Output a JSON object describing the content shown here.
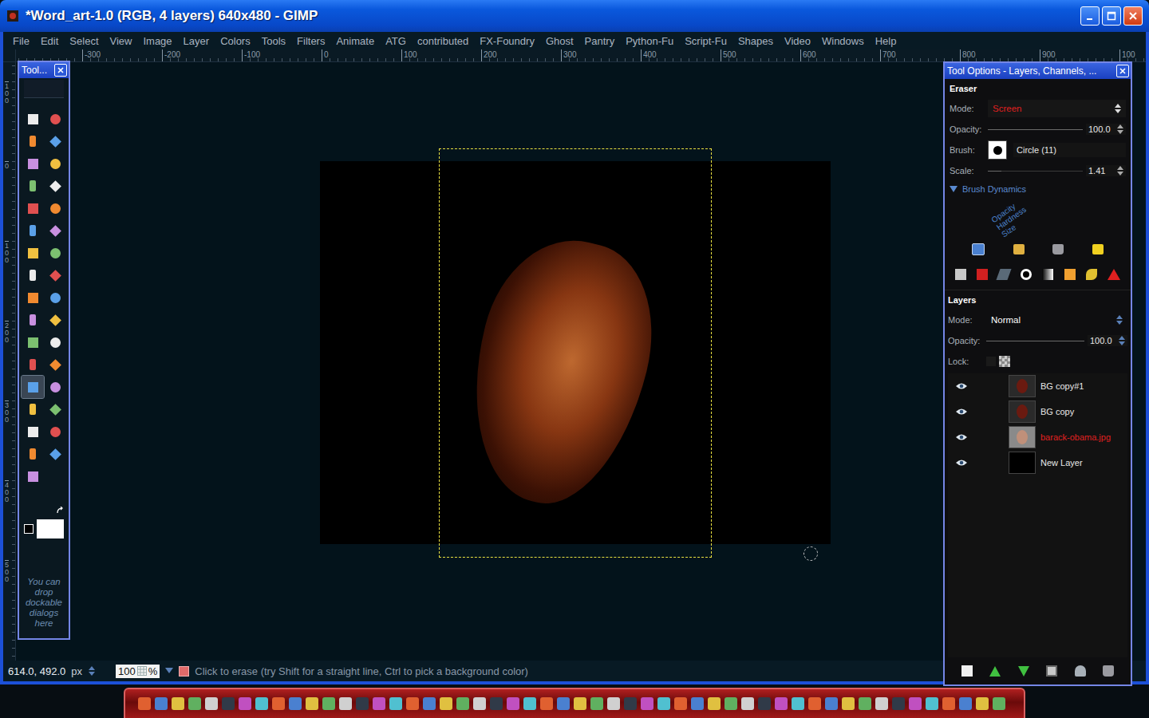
{
  "window": {
    "title": "*Word_art-1.0 (RGB, 4 layers) 640x480 - GIMP"
  },
  "menu": [
    "File",
    "Edit",
    "Select",
    "View",
    "Image",
    "Layer",
    "Colors",
    "Tools",
    "Filters",
    "Animate",
    "ATG",
    "contributed",
    "FX-Foundry",
    "Ghost",
    "Pantry",
    "Python-Fu",
    "Script-Fu",
    "Shapes",
    "Video",
    "Windows",
    "Help"
  ],
  "rulers": {
    "top": [
      "-300",
      "-200",
      "-100",
      "0",
      "100",
      "200",
      "300",
      "400",
      "500",
      "600",
      "700",
      "800",
      "900",
      "100"
    ],
    "left": [
      "100",
      "0",
      "100",
      "200",
      "300",
      "400",
      "500"
    ]
  },
  "toolbox": {
    "title": "Tool...",
    "tools": [
      {
        "selected": false
      },
      {
        "selected": false
      },
      {
        "selected": false
      },
      {
        "selected": false
      },
      {
        "selected": false
      },
      {
        "selected": false
      },
      {
        "selected": false
      },
      {
        "selected": false
      },
      {
        "selected": false
      },
      {
        "selected": false
      },
      {
        "selected": false
      },
      {
        "selected": false
      },
      {
        "selected": false
      },
      {
        "selected": false
      },
      {
        "selected": false
      },
      {
        "selected": false
      },
      {
        "selected": false
      },
      {
        "selected": false
      },
      {
        "selected": false
      },
      {
        "selected": false
      },
      {
        "selected": false
      },
      {
        "selected": false
      },
      {
        "selected": false
      },
      {
        "selected": false
      },
      {
        "selected": true
      },
      {
        "selected": false
      },
      {
        "selected": false
      },
      {
        "selected": false
      },
      {
        "selected": false
      },
      {
        "selected": false
      },
      {
        "selected": false
      },
      {
        "selected": false
      },
      {
        "selected": false
      }
    ],
    "hint": "You can drop dockable dialogs here"
  },
  "status_bar": {
    "coords": "614.0, 492.0",
    "unit": "px",
    "zoom": "100",
    "zoom_unit": "%",
    "message": "Click to erase (try Shift for a straight line, Ctrl to pick a background color)"
  },
  "dock": {
    "title": "Tool Options - Layers, Channels, ...",
    "tool_options": {
      "tool": "Eraser",
      "fields": [
        {
          "kind": "select",
          "label": "Mode:",
          "value": "Screen"
        },
        {
          "kind": "slider",
          "label": "Opacity:",
          "value": "100.0",
          "level": 1
        },
        {
          "kind": "brush",
          "label": "Brush:",
          "value": "Circle (11)"
        },
        {
          "kind": "slider",
          "label": "Scale:",
          "value": "1.41",
          "level": 0.14
        }
      ],
      "dynamics": {
        "label": "Brush Dynamics",
        "expanded": true,
        "axes": [
          "Opacity",
          "Hardness",
          "Size"
        ]
      }
    },
    "layers": {
      "title": "Layers",
      "fields": [
        {
          "kind": "select",
          "label": "Mode:",
          "value": "Normal"
        },
        {
          "kind": "slider",
          "label": "Opacity:",
          "value": "100.0",
          "level": 1
        },
        {
          "kind": "lock",
          "label": "Lock:",
          "checked": false
        }
      ],
      "items": [
        {
          "name": "BG copy#1",
          "visible": true,
          "selected": false,
          "kind": "art"
        },
        {
          "name": "BG copy",
          "visible": true,
          "selected": false,
          "kind": "art"
        },
        {
          "name": "barack-obama.jpg",
          "visible": true,
          "selected": true,
          "kind": "photo"
        },
        {
          "name": "New Layer",
          "visible": true,
          "selected": false,
          "kind": "fill"
        }
      ]
    }
  }
}
